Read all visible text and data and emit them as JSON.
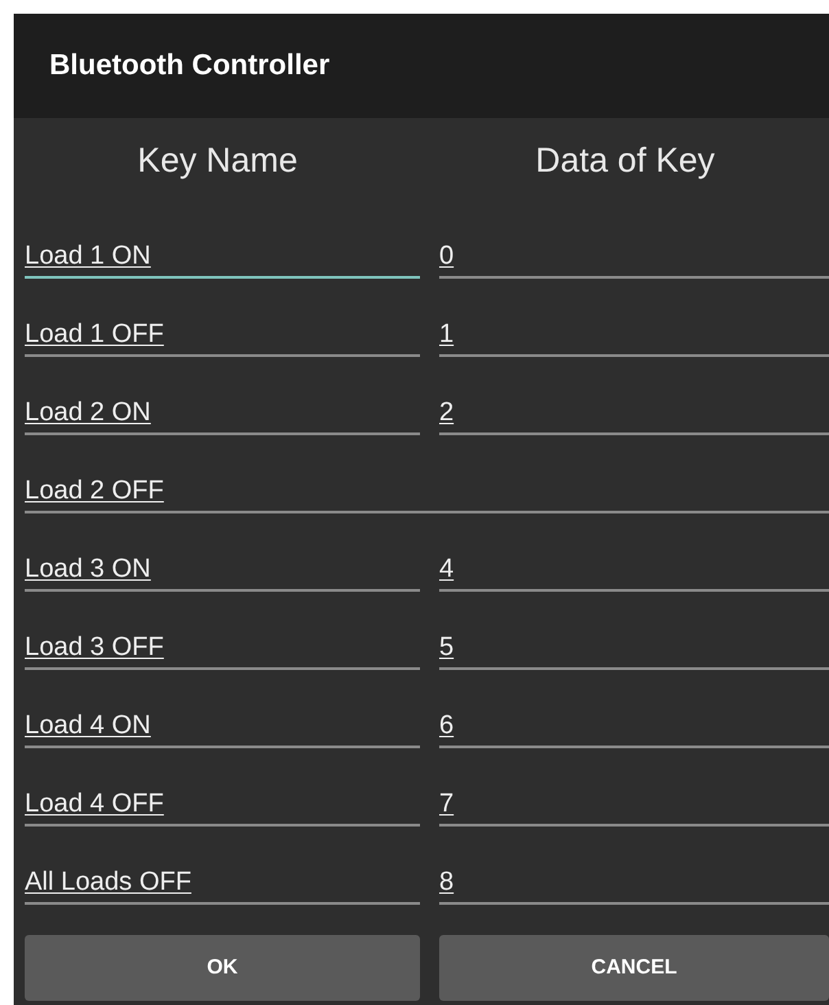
{
  "dialog": {
    "title": "Bluetooth Controller"
  },
  "columns": [
    "Key Name",
    "Data of Key"
  ],
  "rows": [
    {
      "key": "Load 1 ON",
      "value": "0",
      "focused": true
    },
    {
      "key": "Load 1 OFF",
      "value": "1",
      "focused": false
    },
    {
      "key": "Load 2 ON",
      "value": "2",
      "focused": false
    },
    {
      "key": "Load 2 OFF",
      "focused": false
    },
    {
      "key": "Load 3 ON",
      "value": "4",
      "focused": false
    },
    {
      "key": "Load 3 OFF",
      "value": "5",
      "focused": false
    },
    {
      "key": "Load 4 ON",
      "value": "6",
      "focused": false
    },
    {
      "key": "Load 4 OFF",
      "value": "7",
      "focused": false
    },
    {
      "key": "All Loads OFF",
      "value": "8",
      "focused": false
    }
  ],
  "buttons": [
    "OK",
    "CANCEL"
  ]
}
